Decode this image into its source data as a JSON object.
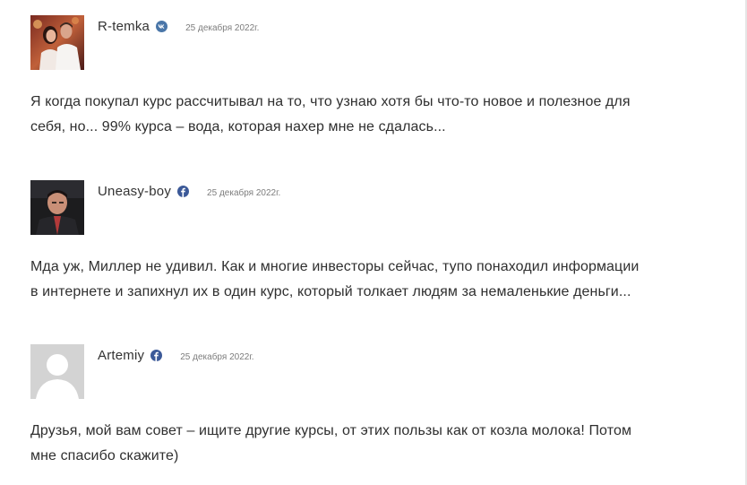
{
  "comments": [
    {
      "author": "R-temka",
      "network_icon": "vk-icon",
      "network_color": "#4a76a8",
      "date": "25 декабря 2022г.",
      "avatar": "photo-couple",
      "text": "Я когда покупал курс рассчитывал на то, что узнаю хотя бы что-то новое и полезное для\nсебя, но... 99% курса – вода, которая нахер мне не сдалась..."
    },
    {
      "author": "Uneasy-boy",
      "network_icon": "facebook-icon",
      "network_color": "#3b5998",
      "date": "25 декабря 2022г.",
      "avatar": "photo-man",
      "text": "Мда уж, Миллер не удивил. Как и многие инвесторы сейчас, тупо понаходил информации\nв интернете и запихнул их в один курс, который толкает людям за немаленькие деньги..."
    },
    {
      "author": "Artemiy",
      "network_icon": "facebook-icon",
      "network_color": "#3b5998",
      "date": "25 декабря 2022г.",
      "avatar": "default-avatar",
      "text": "Друзья, мой вам совет – ищите другие курсы, от этих пользы как от козла молока! Потом\nмне спасибо скажите)"
    }
  ]
}
